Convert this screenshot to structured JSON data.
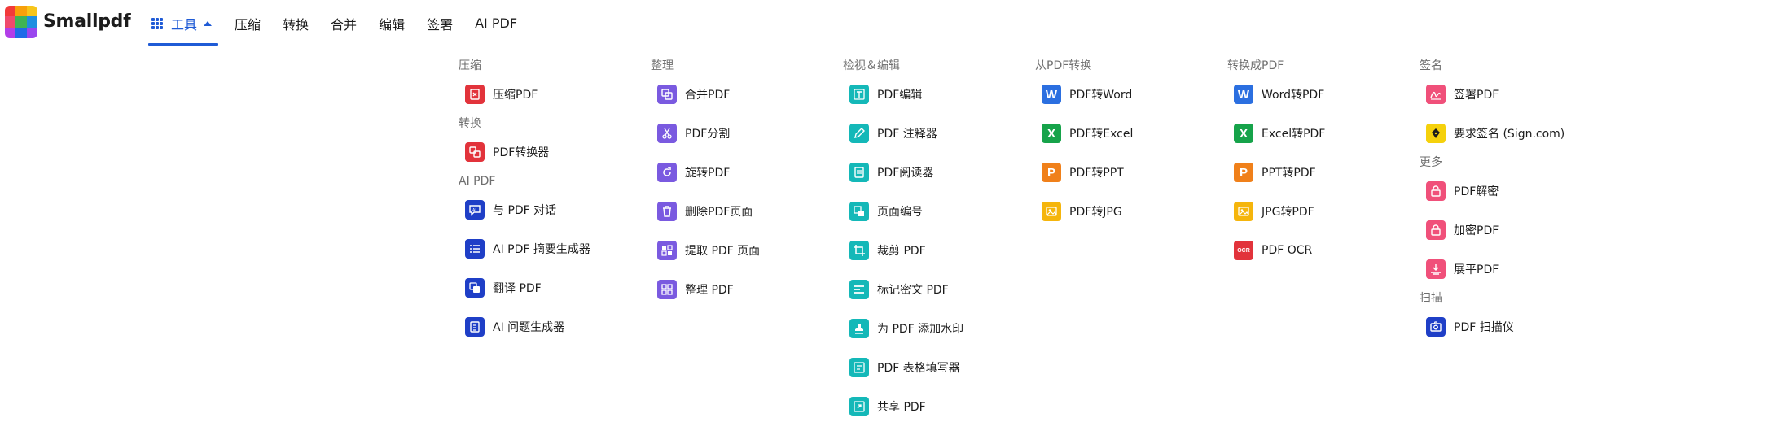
{
  "brand": {
    "name": "Smallpdf",
    "logo_colors": [
      "#f23a3a",
      "#f7a00b",
      "#f7c51a",
      "#ef4a6c",
      "#3fb455",
      "#1f8fe0",
      "#b23ee8",
      "#1e6be8",
      "#9a47ee"
    ]
  },
  "nav": {
    "tools_label": "工具",
    "links": [
      "压缩",
      "转换",
      "合并",
      "编辑",
      "签署",
      "AI PDF"
    ]
  },
  "menu": {
    "columns": [
      {
        "groups": [
          {
            "title": "压缩",
            "items": [
              {
                "label": "压缩PDF",
                "icon": "compress-icon",
                "color": "#e2333b"
              }
            ]
          },
          {
            "title": "转换",
            "items": [
              {
                "label": "PDF转换器",
                "icon": "convert-icon",
                "color": "#e2333b"
              }
            ]
          },
          {
            "title": "AI PDF",
            "items": [
              {
                "label": "与 PDF 对话",
                "icon": "chat-icon",
                "color": "#1f3fc7"
              },
              {
                "label": "AI PDF 摘要生成器",
                "icon": "summary-list-icon",
                "color": "#1f3fc7"
              },
              {
                "label": "翻译 PDF",
                "icon": "translate-icon",
                "color": "#1f3fc7"
              },
              {
                "label": "AI 问题生成器",
                "icon": "question-doc-icon",
                "color": "#1f3fc7"
              }
            ]
          }
        ]
      },
      {
        "groups": [
          {
            "title": "整理",
            "items": [
              {
                "label": "合并PDF",
                "icon": "merge-icon",
                "color": "#7a5ae0"
              },
              {
                "label": "PDF分割",
                "icon": "scissors-icon",
                "color": "#7a5ae0"
              },
              {
                "label": "旋转PDF",
                "icon": "rotate-icon",
                "color": "#7a5ae0"
              },
              {
                "label": "删除PDF页面",
                "icon": "trash-icon",
                "color": "#7a5ae0"
              },
              {
                "label": "提取 PDF 页面",
                "icon": "extract-icon",
                "color": "#7a5ae0"
              },
              {
                "label": "整理 PDF",
                "icon": "organize-grid-icon",
                "color": "#7a5ae0"
              }
            ]
          }
        ]
      },
      {
        "groups": [
          {
            "title": "检视＆编辑",
            "items": [
              {
                "label": "PDF编辑",
                "icon": "edit-text-icon",
                "color": "#14b8b8"
              },
              {
                "label": "PDF 注释器",
                "icon": "pencil-icon",
                "color": "#14b8b8"
              },
              {
                "label": "PDF阅读器",
                "icon": "reader-icon",
                "color": "#14b8b8"
              },
              {
                "label": "页面编号",
                "icon": "page-number-icon",
                "color": "#14b8b8"
              },
              {
                "label": "裁剪 PDF",
                "icon": "crop-icon",
                "color": "#14b8b8"
              },
              {
                "label": "标记密文 PDF",
                "icon": "redact-icon",
                "color": "#14b8b8"
              },
              {
                "label": "为 PDF 添加水印",
                "icon": "stamp-icon",
                "color": "#14b8b8"
              },
              {
                "label": "PDF 表格填写器",
                "icon": "form-icon",
                "color": "#14b8b8"
              },
              {
                "label": "共享 PDF",
                "icon": "share-icon",
                "color": "#14b8b8"
              }
            ]
          }
        ]
      },
      {
        "groups": [
          {
            "title": "从PDF转换",
            "items": [
              {
                "label": "PDF转Word",
                "icon": "word-icon",
                "color": "#2b6fe0",
                "glyph": "W"
              },
              {
                "label": "PDF转Excel",
                "icon": "excel-icon",
                "color": "#16a34a",
                "glyph": "X"
              },
              {
                "label": "PDF转PPT",
                "icon": "ppt-icon",
                "color": "#f0801a",
                "glyph": "P"
              },
              {
                "label": "PDF转JPG",
                "icon": "jpg-image-icon",
                "color": "#f5b50c"
              }
            ]
          }
        ]
      },
      {
        "groups": [
          {
            "title": "转换成PDF",
            "items": [
              {
                "label": "Word转PDF",
                "icon": "word-icon",
                "color": "#2b6fe0",
                "glyph": "W"
              },
              {
                "label": "Excel转PDF",
                "icon": "excel-icon",
                "color": "#16a34a",
                "glyph": "X"
              },
              {
                "label": "PPT转PDF",
                "icon": "ppt-icon",
                "color": "#f0801a",
                "glyph": "P"
              },
              {
                "label": "JPG转PDF",
                "icon": "jpg-image-icon",
                "color": "#f5b50c"
              },
              {
                "label": "PDF OCR",
                "icon": "ocr-icon",
                "color": "#e2333b",
                "glyph": "OCR"
              }
            ]
          }
        ]
      },
      {
        "groups": [
          {
            "title": "签名",
            "items": [
              {
                "label": "签署PDF",
                "icon": "sign-icon",
                "color": "#f0507a"
              },
              {
                "label": "要求签名 (Sign.com)",
                "icon": "pen-nib-icon",
                "color": "#f5d10c"
              }
            ]
          },
          {
            "title": "更多",
            "items": [
              {
                "label": "PDF解密",
                "icon": "unlock-icon",
                "color": "#f0507a"
              },
              {
                "label": "加密PDF",
                "icon": "lock-icon",
                "color": "#f0507a"
              },
              {
                "label": "展平PDF",
                "icon": "flatten-icon",
                "color": "#f0507a"
              }
            ]
          },
          {
            "title": "扫描",
            "items": [
              {
                "label": "PDF 扫描仪",
                "icon": "camera-icon",
                "color": "#1f3fc7"
              }
            ]
          }
        ]
      }
    ]
  }
}
